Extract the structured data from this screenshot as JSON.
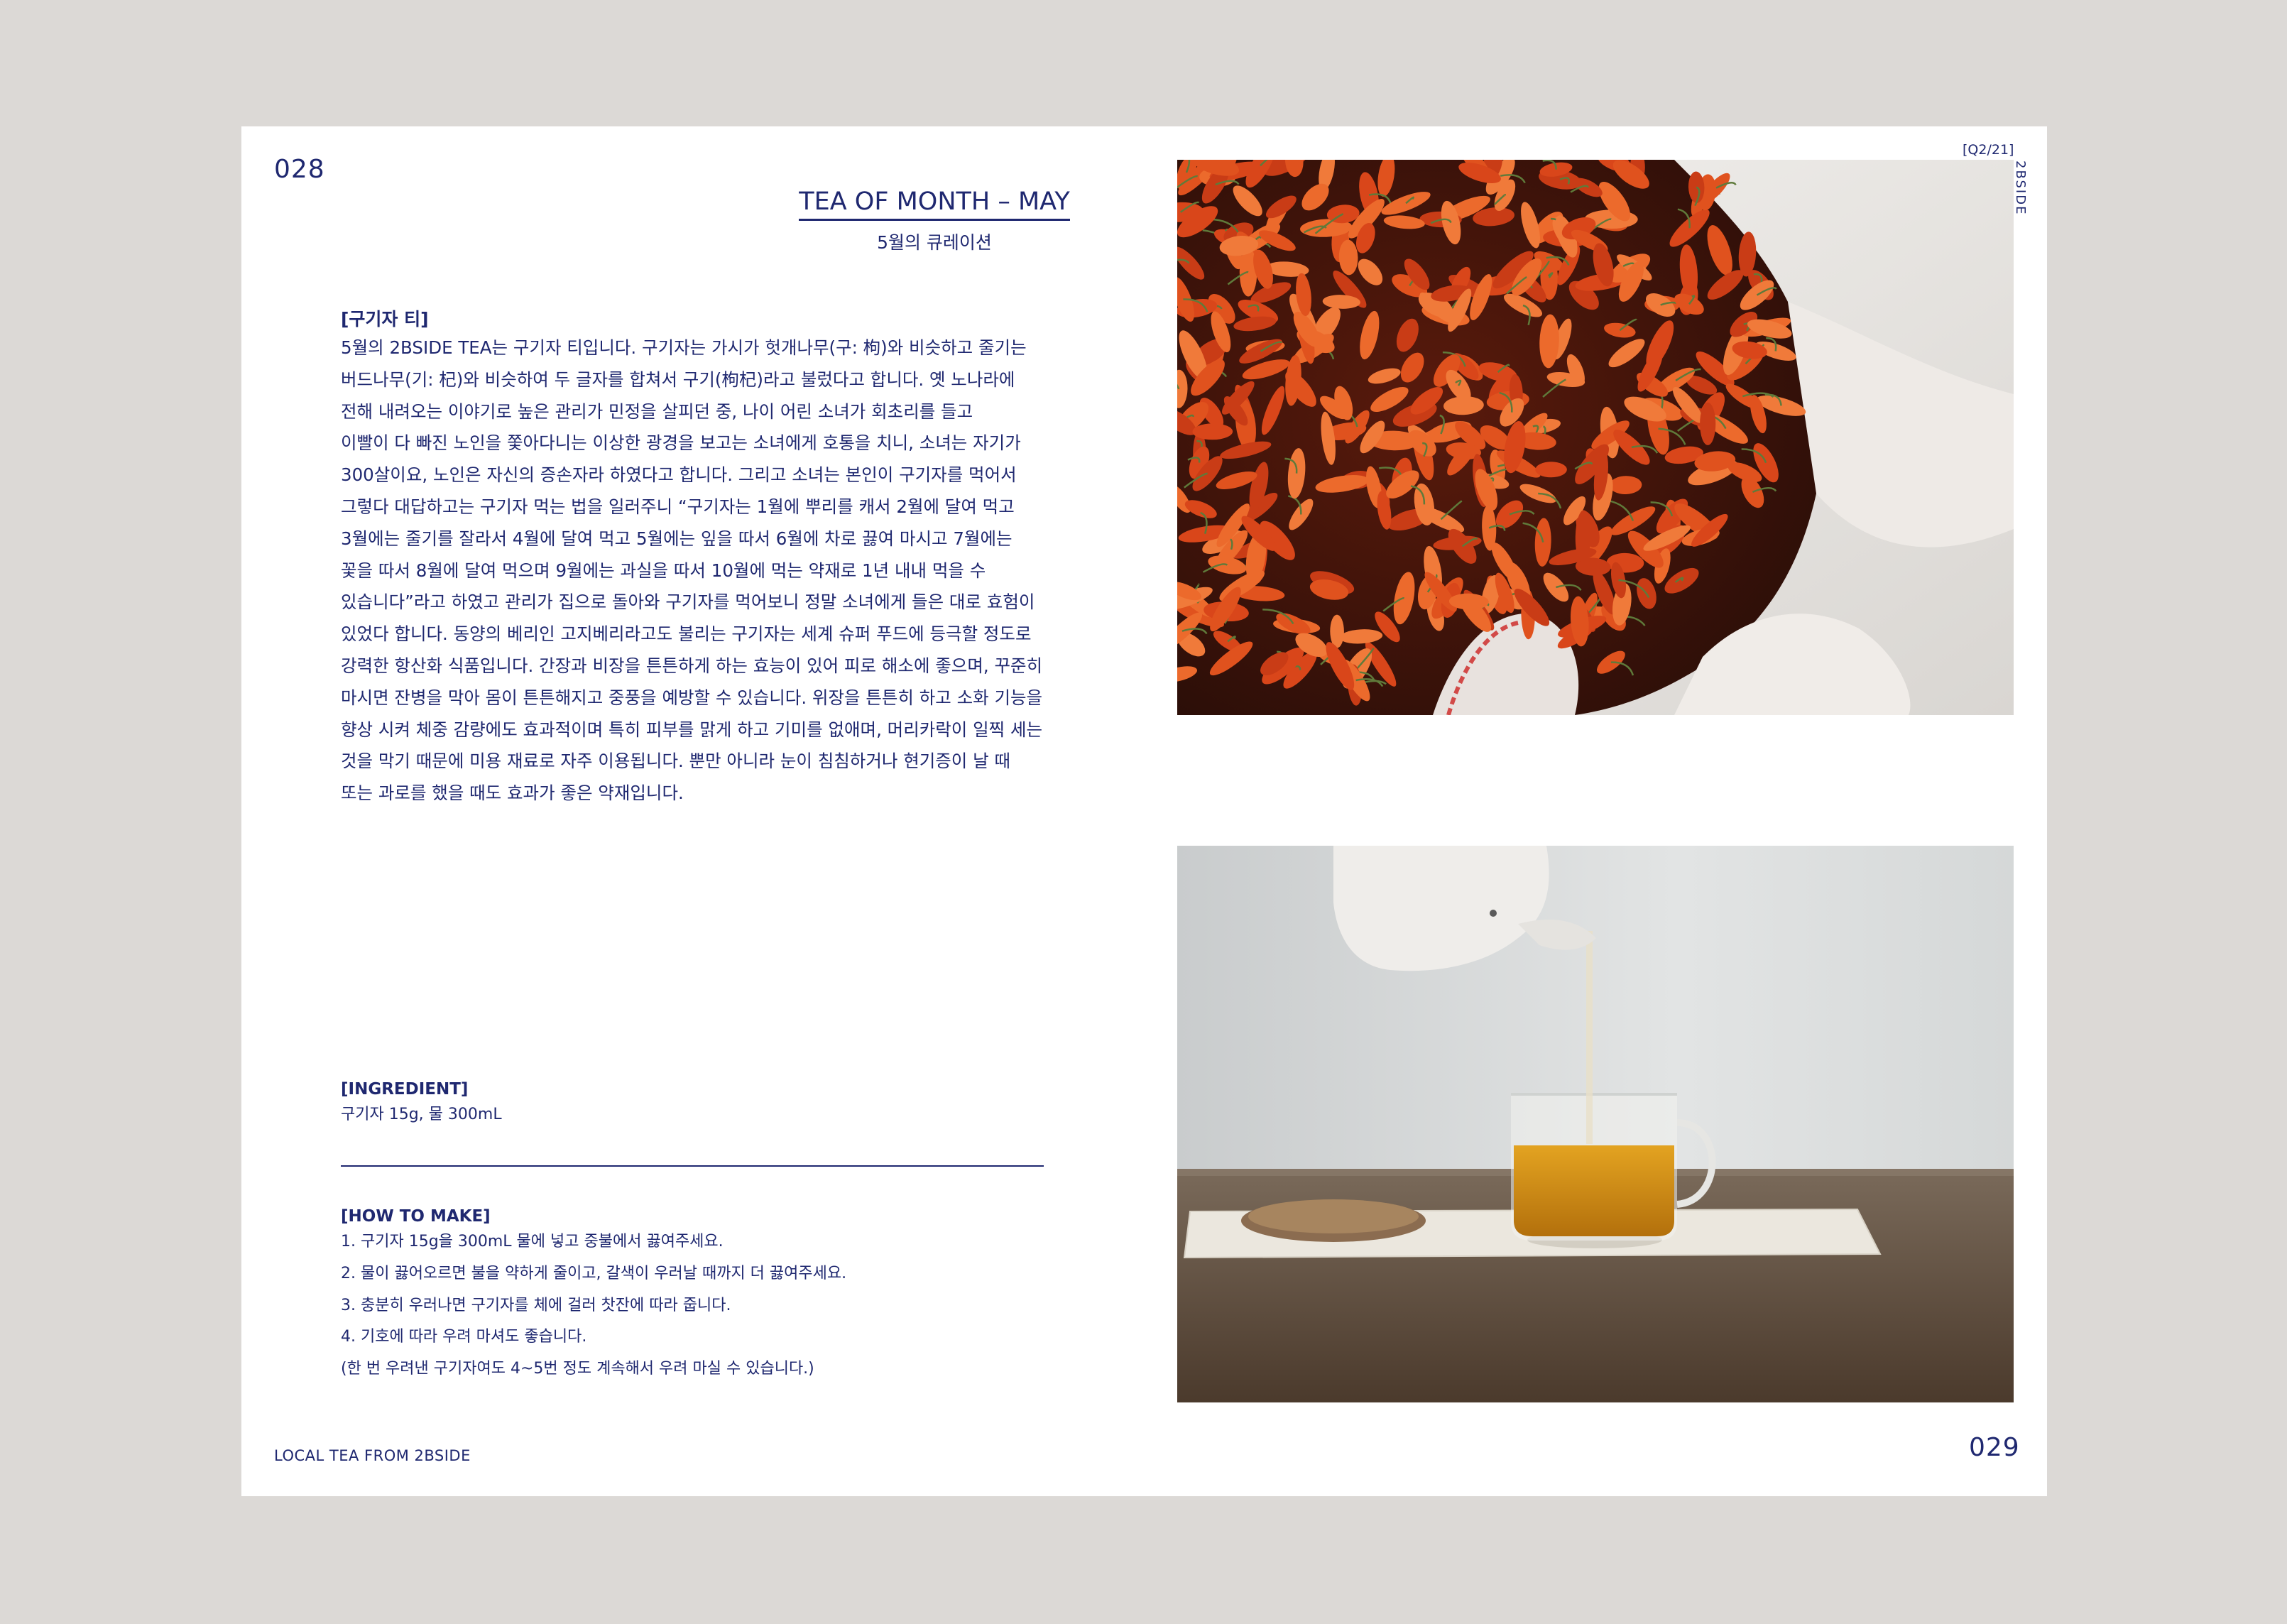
{
  "left_page": {
    "page_number": "028",
    "title": "TEA OF MONTH – MAY",
    "subtitle": "5월의 큐레이션",
    "section_title": "[구기자 티]",
    "body_lines": [
      "5월의 2BSIDE TEA는 구기자 티입니다. 구기자는 가시가 헛개나무(구: 枸)와 비슷하고 줄기는",
      "버드나무(기: 杞)와 비슷하여 두 글자를 합쳐서 구기(枸杞)라고 불렀다고 합니다. 옛 노나라에",
      "전해 내려오는 이야기로 높은 관리가 민정을 살피던 중, 나이 어린 소녀가 회초리를 들고",
      "이빨이 다 빠진 노인을 쫓아다니는 이상한 광경을 보고는 소녀에게 호통을 치니, 소녀는 자기가",
      "300살이요, 노인은 자신의 증손자라 하였다고 합니다. 그리고 소녀는 본인이 구기자를 먹어서",
      "그렇다 대답하고는 구기자 먹는 법을 일러주니 “구기자는 1월에 뿌리를 캐서 2월에 달여 먹고",
      "3월에는 줄기를 잘라서 4월에 달여 먹고 5월에는 잎을 따서 6월에 차로 끓여 마시고 7월에는",
      "꽃을 따서 8월에 달여 먹으며 9월에는 과실을 따서 10월에 먹는 약재로 1년 내내 먹을 수",
      "있습니다”라고 하였고 관리가 집으로 돌아와 구기자를 먹어보니 정말 소녀에게 들은 대로 효험이",
      "있었다 합니다. 동양의 베리인 고지베리라고도 불리는 구기자는 세계 슈퍼 푸드에 등극할 정도로",
      "강력한 항산화 식품입니다. 간장과 비장을 튼튼하게 하는 효능이 있어 피로 해소에 좋으며, 꾸준히",
      "마시면 잔병을 막아 몸이 튼튼해지고 중풍을 예방할 수 있습니다. 위장을 튼튼히 하고 소화 기능을",
      "향상 시켜 체중 감량에도 효과적이며 특히 피부를 맑게 하고 기미를 없애며, 머리카락이 일찍 세는",
      "것을 막기 때문에 미용 재료로 자주 이용됩니다. 뿐만 아니라 눈이 침침하거나 현기증이 날 때",
      "또는 과로를 했을 때도 효과가 좋은 약재입니다."
    ],
    "ingredient_title": "[INGREDIENT]",
    "ingredient_text": "구기자 15g, 물 300mL",
    "howto_title": "[HOW TO MAKE]",
    "howto_steps": [
      "1. 구기자 15g을 300mL 물에 넣고 중불에서 끓여주세요.",
      "2. 물이 끓어오르면 불을 약하게 줄이고, 갈색이 우러날 때까지 더 끓여주세요.",
      "3. 충분히 우러나면 구기자를 체에 걸러 찻잔에 따라 줍니다.",
      "4. 기호에 따라 우려 마셔도 좋습니다.",
      "(한 번 우려낸 구기자여도 4~5번 정도 계속해서 우려 마실 수 있습니다.)"
    ],
    "footer": "LOCAL TEA FROM 2BSIDE"
  },
  "right_page": {
    "issue": "[Q2/21]",
    "brand": "2BSIDE",
    "page_number": "029"
  },
  "colors": {
    "ink": "#1f2870",
    "background": "#dcd9d6",
    "paper": "#ffffff"
  }
}
